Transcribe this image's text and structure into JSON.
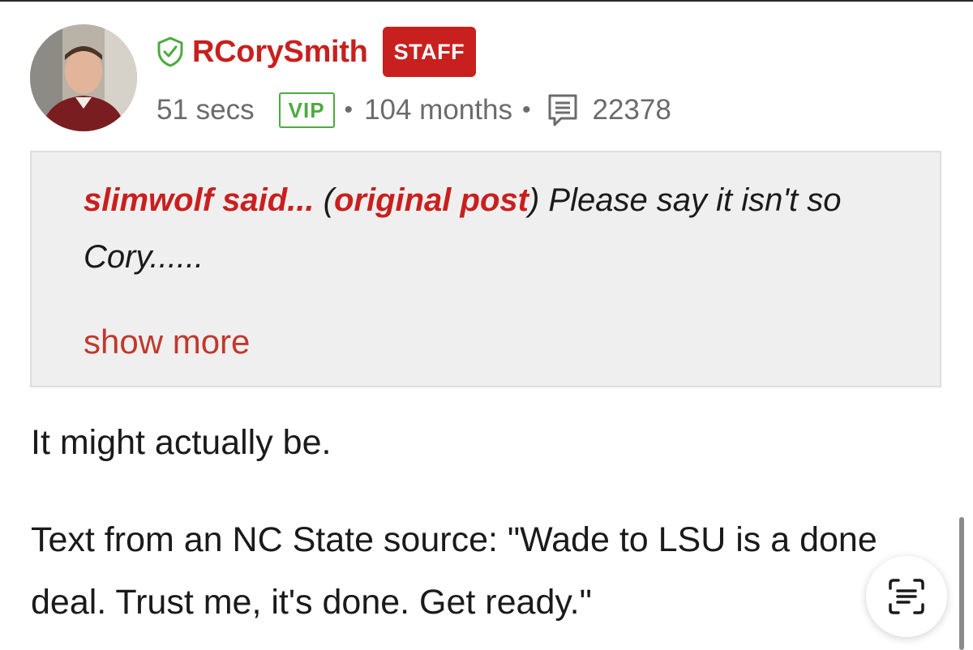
{
  "post": {
    "author": {
      "username": "RCorySmith",
      "badge": "STAFF",
      "time_ago": "51 secs",
      "tier": "VIP",
      "member_for": "104 months",
      "post_count": "22378"
    },
    "quote": {
      "author_label": "slimwolf said...",
      "open_paren": " (",
      "link_label": "original post",
      "text_after_link": ") Please say it isn't so Cory......",
      "show_more": "show more"
    },
    "body": [
      "It might actually be.",
      "Text from an NC State source: \"Wade to LSU is a done deal. Trust me, it's done. Get ready.\""
    ]
  },
  "icons": {
    "verified": "shield-check-icon",
    "posts": "message-lines-icon",
    "live_text": "live-text-icon"
  },
  "colors": {
    "brand_red": "#c8201e",
    "vip_green": "#4caa3f",
    "meta_gray": "#6b6b6b",
    "quote_bg": "#efefef"
  }
}
